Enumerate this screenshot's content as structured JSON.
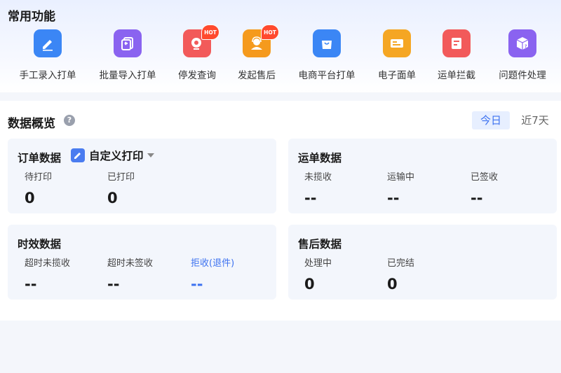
{
  "common": {
    "title": "常用功能",
    "items": [
      {
        "label": "手工录入打单",
        "icon": "pencil-edit-icon",
        "color": "#3b86f5",
        "hot": false
      },
      {
        "label": "批量导入打单",
        "icon": "import-icon",
        "color": "#8a63f0",
        "hot": false
      },
      {
        "label": "停发查询",
        "icon": "location-pin-icon",
        "color": "#f25a5a",
        "hot": true
      },
      {
        "label": "发起售后",
        "icon": "service-agent-icon",
        "color": "#f59a1d",
        "hot": true
      },
      {
        "label": "电商平台打单",
        "icon": "shopping-bag-icon",
        "color": "#3b86f5",
        "hot": false
      },
      {
        "label": "电子面单",
        "icon": "waybill-card-icon",
        "color": "#f5a623",
        "hot": false
      },
      {
        "label": "运单拦截",
        "icon": "waybill-intercept-icon",
        "color": "#f25a5a",
        "hot": false
      },
      {
        "label": "问题件处理",
        "icon": "problem-package-icon",
        "color": "#8a63f0",
        "hot": false
      }
    ],
    "hot_label": "HOT"
  },
  "overview": {
    "title": "数据概览",
    "help": "?",
    "range_today": "今日",
    "range_7d": "近7天",
    "order": {
      "title": "订单数据",
      "print_label": "自定义打印",
      "stats": [
        {
          "label": "待打印",
          "value": "0"
        },
        {
          "label": "已打印",
          "value": "0"
        }
      ]
    },
    "waybill": {
      "title": "运单数据",
      "stats": [
        {
          "label": "未揽收",
          "value": "--"
        },
        {
          "label": "运输中",
          "value": "--"
        },
        {
          "label": "已签收",
          "value": "--"
        }
      ]
    },
    "timeliness": {
      "title": "时效数据",
      "stats": [
        {
          "label": "超时未揽收",
          "value": "--"
        },
        {
          "label": "超时未签收",
          "value": "--"
        },
        {
          "label": "拒收(退件)",
          "value": "--"
        }
      ]
    },
    "aftersale": {
      "title": "售后数据",
      "stats": [
        {
          "label": "处理中",
          "value": "0"
        },
        {
          "label": "已完结",
          "value": "0"
        }
      ]
    }
  },
  "colors": {
    "accent": "#3d72f0"
  }
}
